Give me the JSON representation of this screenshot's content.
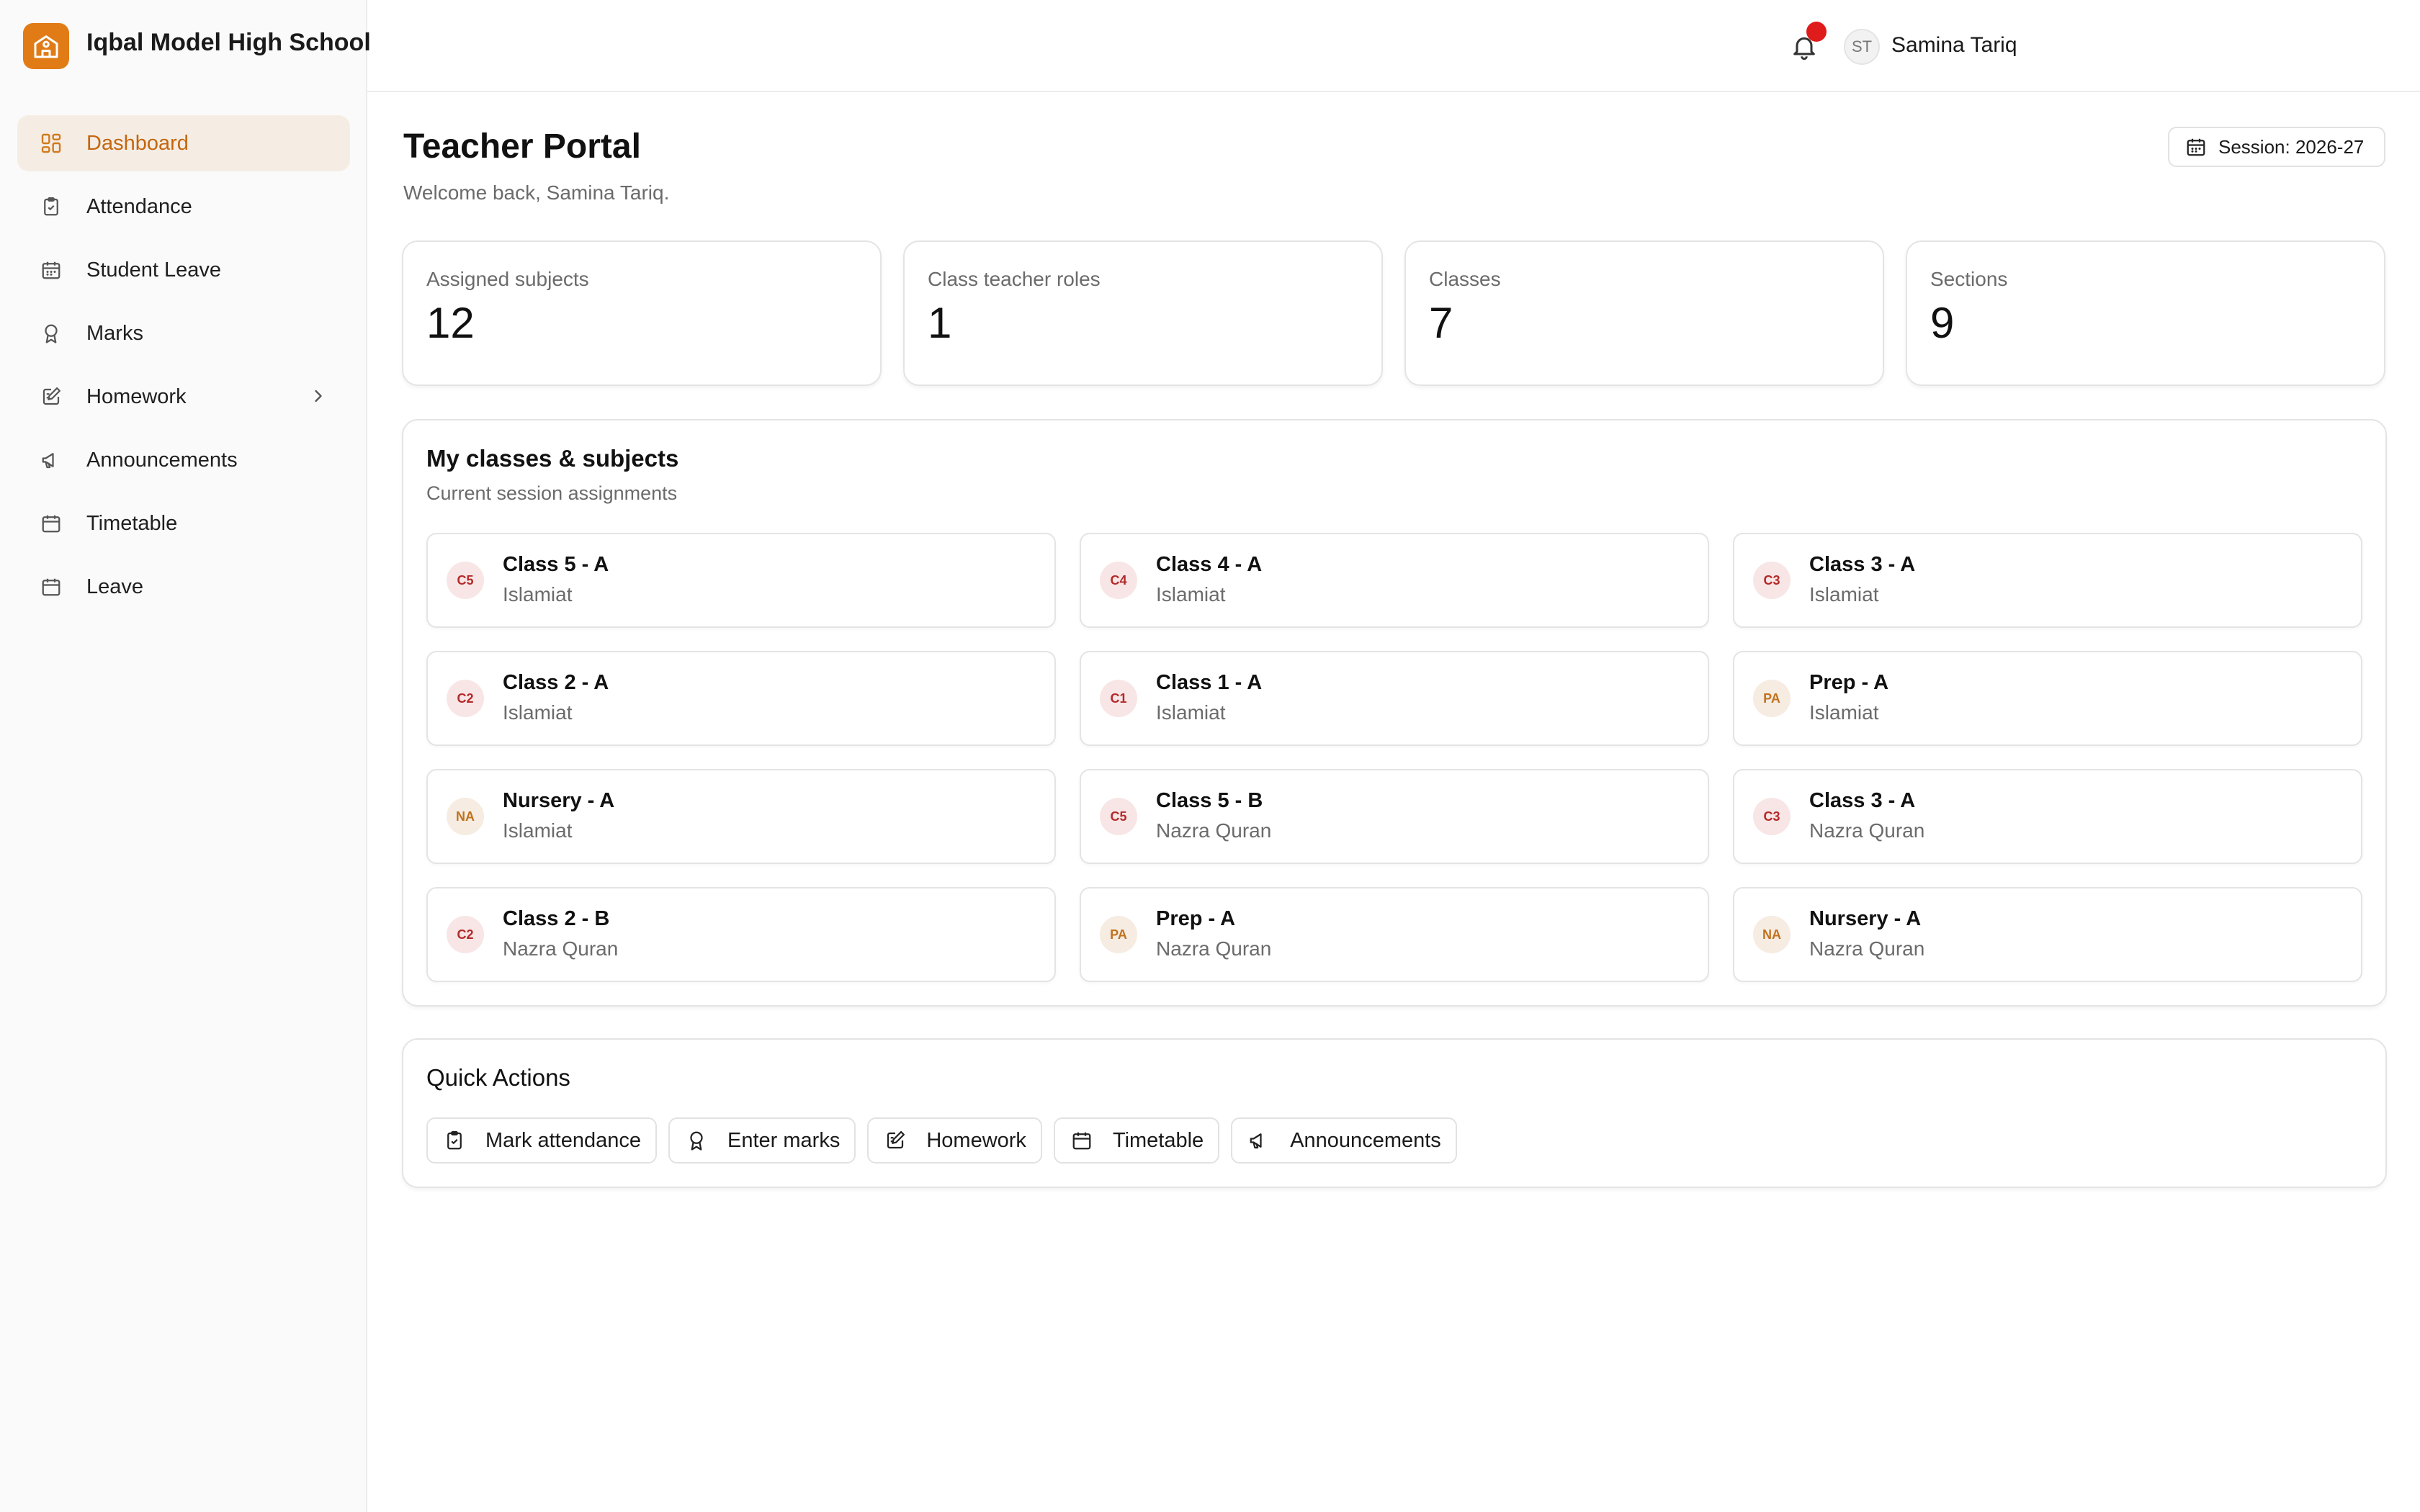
{
  "brand": {
    "name": "Iqbal Model High School",
    "logo_icon": "school-icon",
    "accent": "#e07b16"
  },
  "sidebar": {
    "items": [
      {
        "label": "Dashboard",
        "icon": "dashboard-icon",
        "active": true
      },
      {
        "label": "Attendance",
        "icon": "clipboard-check-icon",
        "active": false
      },
      {
        "label": "Student Leave",
        "icon": "calendar-icon",
        "active": false
      },
      {
        "label": "Marks",
        "icon": "award-icon",
        "active": false
      },
      {
        "label": "Homework",
        "icon": "edit-square-icon",
        "active": false,
        "has_submenu": true
      },
      {
        "label": "Announcements",
        "icon": "megaphone-icon",
        "active": false
      },
      {
        "label": "Timetable",
        "icon": "calendar-icon",
        "active": false
      },
      {
        "label": "Leave",
        "icon": "calendar-icon",
        "active": false
      }
    ]
  },
  "topbar": {
    "notification_count": "",
    "avatar_initials": "ST",
    "user_name": "Samina Tariq",
    "notification_dot_color": "#e01b1b"
  },
  "header": {
    "title": "Teacher Portal",
    "subtitle": "Welcome back, Samina Tariq.",
    "session_label": "Session: 2026-27"
  },
  "stats": [
    {
      "label": "Assigned subjects",
      "value": "12"
    },
    {
      "label": "Class teacher roles",
      "value": "1"
    },
    {
      "label": "Classes",
      "value": "7"
    },
    {
      "label": "Sections",
      "value": "9"
    }
  ],
  "assignments": {
    "title": "My classes & subjects",
    "subtitle": "Current session assignments",
    "items": [
      {
        "badge": "C5",
        "badge_color": "red",
        "name": "Class 5 - A",
        "subject": "Islamiat"
      },
      {
        "badge": "C4",
        "badge_color": "red",
        "name": "Class 4 - A",
        "subject": "Islamiat"
      },
      {
        "badge": "C3",
        "badge_color": "red",
        "name": "Class 3 - A",
        "subject": "Islamiat"
      },
      {
        "badge": "C2",
        "badge_color": "red",
        "name": "Class 2 - A",
        "subject": "Islamiat"
      },
      {
        "badge": "C1",
        "badge_color": "red",
        "name": "Class 1 - A",
        "subject": "Islamiat"
      },
      {
        "badge": "PA",
        "badge_color": "orange",
        "name": "Prep - A",
        "subject": "Islamiat"
      },
      {
        "badge": "NA",
        "badge_color": "orange",
        "name": "Nursery - A",
        "subject": "Islamiat"
      },
      {
        "badge": "C5",
        "badge_color": "red",
        "name": "Class 5 - B",
        "subject": "Nazra Quran"
      },
      {
        "badge": "C3",
        "badge_color": "red",
        "name": "Class 3 - A",
        "subject": "Nazra Quran"
      },
      {
        "badge": "C2",
        "badge_color": "red",
        "name": "Class 2 - B",
        "subject": "Nazra Quran"
      },
      {
        "badge": "PA",
        "badge_color": "orange",
        "name": "Prep - A",
        "subject": "Nazra Quran"
      },
      {
        "badge": "NA",
        "badge_color": "orange",
        "name": "Nursery - A",
        "subject": "Nazra Quran"
      }
    ]
  },
  "quick_actions": {
    "title": "Quick Actions",
    "buttons": [
      {
        "label": "Mark attendance",
        "icon": "clipboard-check-icon"
      },
      {
        "label": "Enter marks",
        "icon": "award-icon"
      },
      {
        "label": "Homework",
        "icon": "edit-square-icon"
      },
      {
        "label": "Timetable",
        "icon": "calendar-icon"
      },
      {
        "label": "Announcements",
        "icon": "megaphone-icon"
      }
    ]
  }
}
